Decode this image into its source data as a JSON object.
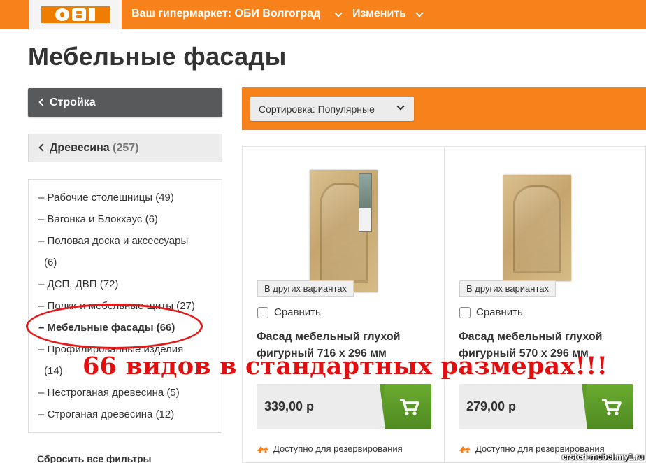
{
  "header": {
    "logo_text": "OBI",
    "market_label": "Ваш гипермаркет: ОБИ Волгоград",
    "change_label": "Изменить",
    "bg_color": "#f7821b"
  },
  "page_title": "Мебельные фасады",
  "sidebar": {
    "back_label": "Стройка",
    "category_label": "Древесина",
    "category_count": "(257)",
    "items": [
      {
        "label": "– Рабочие столешницы (49)"
      },
      {
        "label": "– Вагонка и Блокхаус (6)"
      },
      {
        "label": "– Половая доска и аксессуары"
      },
      {
        "label": "(6)"
      },
      {
        "label": "– ДСП, ДВП (72)"
      },
      {
        "label": "– Полки и мебельные щиты (27)"
      },
      {
        "label": "– Мебельные фасады (66)"
      },
      {
        "label": "– Профилированные изделия"
      },
      {
        "label": "(14)"
      },
      {
        "label": "– Нестроганая древесина (5)"
      },
      {
        "label": "– Строганая древесина (12)"
      }
    ],
    "reset_label": "Сбросить все фильтры"
  },
  "sort": {
    "label": "Сортировка: Популярные"
  },
  "products": [
    {
      "variant_tag": "В других вариантах",
      "compare_label": "Сравнить",
      "name_line1": "Фасад мебельный глухой",
      "name_line2": "фигурный 716 х 296 мм",
      "price": "339,00 р",
      "availability": "Доступно для резервирования"
    },
    {
      "variant_tag": "В других вариантах",
      "compare_label": "Сравнить",
      "name_line1": "Фасад мебельный глухой",
      "name_line2": "фигурный 570 х 296 мм",
      "price": "279,00 р",
      "availability": "Доступно для резервирования"
    }
  ],
  "overlay_text": "66 видов в стандартных размерах!!!",
  "watermark": "ersted-mebel.my1.ru",
  "colors": {
    "accent": "#f7821b",
    "cart": "#5f9e2b",
    "annotation": "#e10f0f"
  }
}
